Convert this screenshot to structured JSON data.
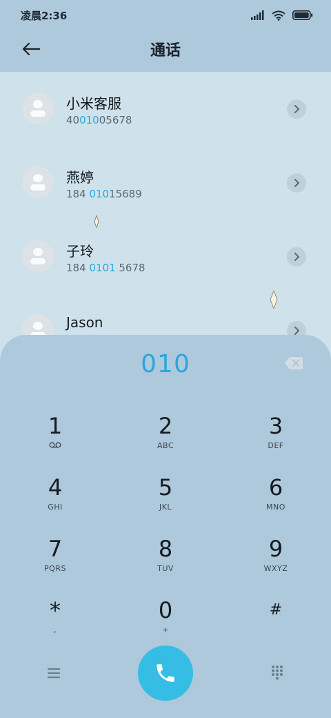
{
  "status_bar": {
    "time": "凌晨2:36"
  },
  "header": {
    "title": "通话"
  },
  "contacts": [
    {
      "name": "小米客服",
      "number_pre": "40",
      "number_hl": "010",
      "number_post": "05678"
    },
    {
      "name": "燕婷",
      "number_pre": "184 ",
      "number_hl": "010",
      "number_post": "15689"
    },
    {
      "name": "子玲",
      "number_pre": "184 ",
      "number_hl": "0101",
      "number_post": " 5678"
    },
    {
      "name": "Jason",
      "number_pre": "",
      "number_hl": "",
      "number_post": ""
    }
  ],
  "dialpad": {
    "input": "010",
    "keys": [
      {
        "digit": "1",
        "letters": ""
      },
      {
        "digit": "2",
        "letters": "ABC"
      },
      {
        "digit": "3",
        "letters": "DEF"
      },
      {
        "digit": "4",
        "letters": "GHI"
      },
      {
        "digit": "5",
        "letters": "JKL"
      },
      {
        "digit": "6",
        "letters": "MNO"
      },
      {
        "digit": "7",
        "letters": "PQRS"
      },
      {
        "digit": "8",
        "letters": "TUV"
      },
      {
        "digit": "9",
        "letters": "WXYZ"
      },
      {
        "digit": "*",
        "letters": ","
      },
      {
        "digit": "0",
        "letters": "+"
      },
      {
        "digit": "#",
        "letters": ""
      }
    ]
  },
  "icons": {
    "back": "arrow-left-icon",
    "chevron": "chevron-right-icon",
    "backspace": "backspace-icon",
    "voicemail": "voicemail-icon",
    "menu": "menu-icon",
    "call": "phone-icon",
    "keypad": "keypad-icon"
  },
  "colors": {
    "accent": "#2aa7de",
    "call_button": "#36bde6",
    "header_bg": "#aec8dc",
    "list_bg": "#cfe1ea"
  }
}
